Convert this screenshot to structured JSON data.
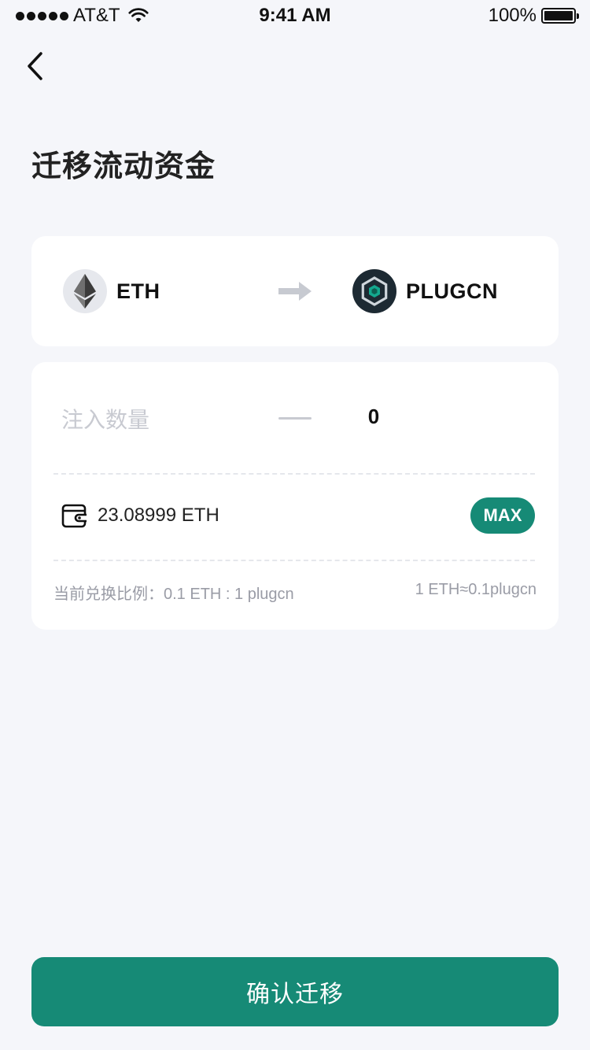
{
  "status_bar": {
    "carrier": "AT&T",
    "time": "9:41 AM",
    "battery": "100%",
    "battery_level": 1.0
  },
  "page": {
    "title": "迁移流动资金"
  },
  "tokens": {
    "from": {
      "name": "ETH",
      "icon": "ethereum-icon"
    },
    "to": {
      "name": "PLUGCN",
      "icon": "plugcn-icon"
    }
  },
  "amount": {
    "label": "注入数量",
    "value": "0"
  },
  "balance": {
    "text": "23.08999 ETH",
    "max_label": "MAX"
  },
  "rate": {
    "left": "当前兑换比例：0.1 ETH : 1 plugcn",
    "right": "1 ETH≈0.1plugcn"
  },
  "confirm_label": "确认迁移",
  "colors": {
    "accent": "#168a76",
    "background": "#f5f6fa",
    "muted_text": "#9a9ca6"
  }
}
